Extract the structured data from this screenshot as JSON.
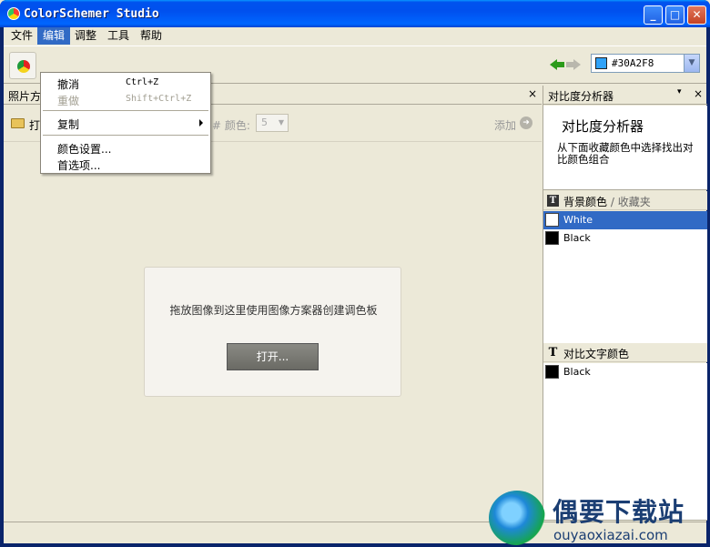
{
  "window": {
    "title": "ColorSchemer Studio",
    "minimize": "_",
    "maximize": "□",
    "close": "✕"
  },
  "menubar": {
    "items": [
      "文件",
      "编辑",
      "调整",
      "工具",
      "帮助"
    ],
    "active": "编辑"
  },
  "toolbar": {
    "current_color_hex": "#30A2F8",
    "current_color": "#30a2f8",
    "combo_arrow": "▼"
  },
  "edit_menu": {
    "items": [
      {
        "label": "撤消",
        "shortcut": "Ctrl+Z",
        "enabled": true
      },
      {
        "label": "重做",
        "shortcut": "Shift+Ctrl+Z",
        "enabled": false
      },
      {
        "label": "复制",
        "shortcut": "",
        "enabled": true,
        "submenu": true
      },
      {
        "label": "颜色设置...",
        "shortcut": "",
        "enabled": true
      },
      {
        "label": "首选项...",
        "shortcut": "",
        "enabled": true
      }
    ]
  },
  "left_panel": {
    "tab_label": "照片方",
    "close": "×",
    "open_label": "打",
    "count_label": "# 颜色:",
    "count_value": "5",
    "count_arrow": "▼",
    "add_label": "添加",
    "add_icon": "➜",
    "drop_text": "拖放图像到这里使用图像方案器创建调色板",
    "open_button": "打开..."
  },
  "right_panel": {
    "header": "对比度分析器",
    "pin": "▾",
    "close": "×",
    "title": "对比度分析器",
    "description": "从下面收藏颜色中选择找出对比颜色组合",
    "background_section": {
      "label": "背景颜色",
      "sublabel": " / 收藏夹",
      "icon": "T",
      "colors": [
        {
          "name": "White",
          "hex": "#ffffff",
          "selected": true
        },
        {
          "name": "Black",
          "hex": "#000000",
          "selected": false
        }
      ]
    },
    "text_section": {
      "label": "对比文字颜色",
      "icon": "T",
      "colors": [
        {
          "name": "Black",
          "hex": "#000000"
        }
      ]
    }
  },
  "watermark": {
    "title": "偶要下载站",
    "url": "ouyaoxiazai.com"
  }
}
